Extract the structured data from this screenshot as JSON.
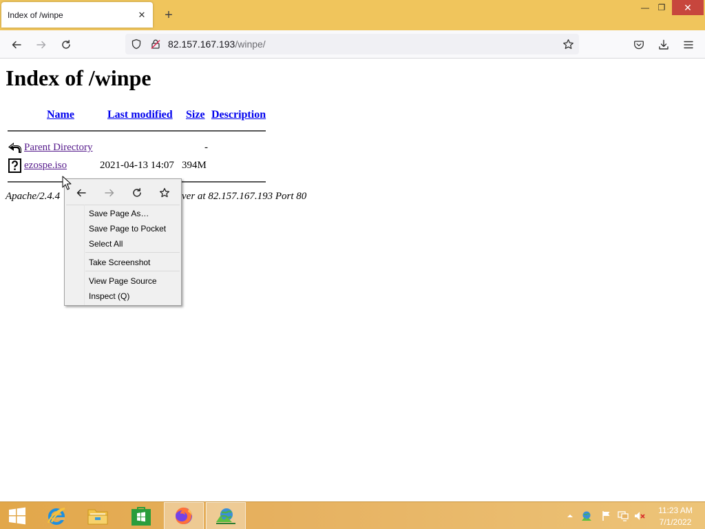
{
  "browser": {
    "tab": {
      "title": "Index of /winpe",
      "close_glyph": "✕"
    },
    "new_tab_glyph": "+",
    "window_controls": {
      "minimize": "—",
      "maximize": "❐",
      "close": "✕"
    },
    "url": {
      "host": "82.157.167.193",
      "path": "/winpe/"
    }
  },
  "page": {
    "heading": "Index of /winpe",
    "columns": {
      "name": "Name",
      "last_modified": "Last modified",
      "size": "Size",
      "description": "Description"
    },
    "rows": [
      {
        "name": "Parent Directory",
        "last_modified": "",
        "size": "-",
        "description": "",
        "icon": "back-icon"
      },
      {
        "name": "ezospe.iso",
        "last_modified": "2021-04-13 14:07",
        "size": "394M",
        "description": "",
        "icon": "unknown-file-icon"
      }
    ],
    "address_left": "Apache/2.4.4",
    "address_right": "ver at 82.157.167.193 Port 80"
  },
  "context_menu": {
    "items": [
      {
        "label": "Save Page As…"
      },
      {
        "label": "Save Page to Pocket"
      },
      {
        "label": "Select All"
      },
      {
        "label": "Take Screenshot"
      },
      {
        "label": "View Page Source"
      },
      {
        "label": "Inspect (Q)"
      }
    ]
  },
  "taskbar": {
    "clock_time": "11:23 AM",
    "clock_date": "7/1/2022",
    "apps": [
      "start",
      "internet-explorer",
      "file-explorer",
      "store",
      "firefox",
      "network-app"
    ]
  },
  "colors": {
    "titlebar": "#f0c55c",
    "link_visited": "#551a8b",
    "link": "#0000ee",
    "taskbar": "#e6b160",
    "close_button": "#c7463d"
  }
}
